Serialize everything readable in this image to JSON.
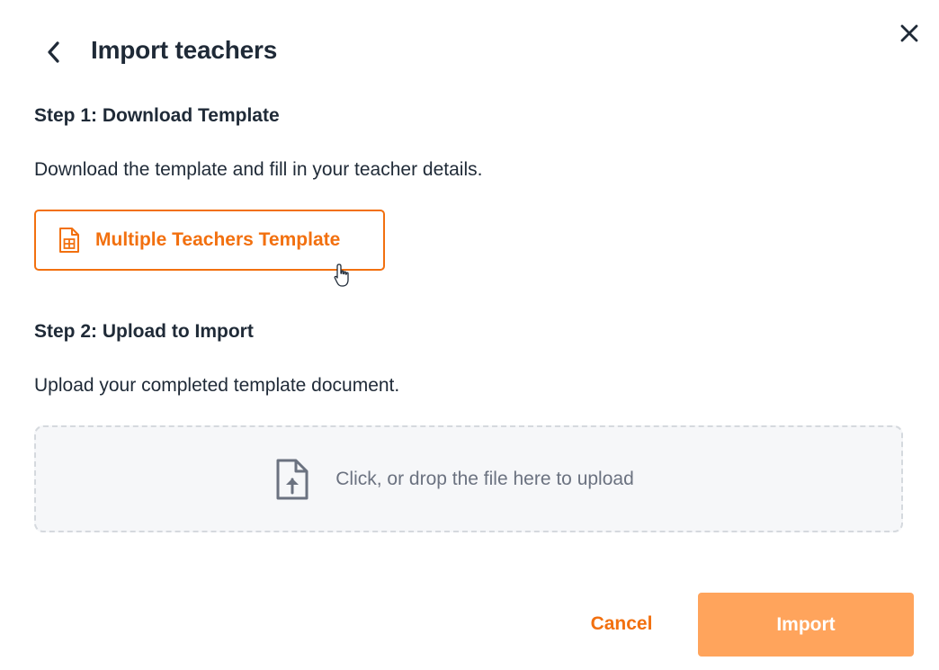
{
  "header": {
    "title": "Import teachers",
    "back_icon": "chevron-left-icon",
    "close_icon": "close-icon"
  },
  "step1": {
    "heading": "Step 1: Download Template",
    "description": "Download the template and fill in your teacher details.",
    "template_button_label": "Multiple Teachers Template",
    "template_icon": "spreadsheet-file-icon"
  },
  "step2": {
    "heading": "Step 2: Upload to Import",
    "description": "Upload your completed template document.",
    "dropzone_hint": "Click, or drop the file here to upload",
    "upload_icon": "file-upload-icon"
  },
  "footer": {
    "cancel_label": "Cancel",
    "import_label": "Import"
  },
  "colors": {
    "accent": "#f2700f",
    "import_button_bg": "#ffa45c",
    "text": "#1f2a37",
    "muted_text": "#6b7280",
    "dropzone_bg": "#f6f7f9",
    "dropzone_border": "#d5d9de"
  }
}
